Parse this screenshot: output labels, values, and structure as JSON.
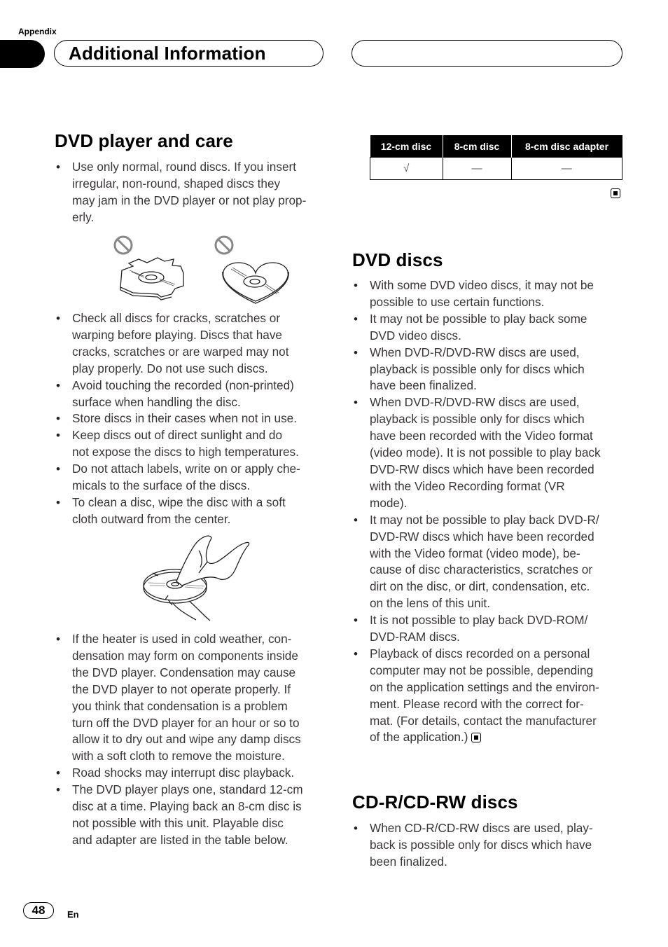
{
  "header": {
    "section_label": "Appendix",
    "chapter_title": "Additional Information"
  },
  "left_column": {
    "heading": "DVD player and care",
    "bullets_top": [
      "Use only normal, round discs. If you insert\nirregular, non-round, shaped discs they\nmay jam in the DVD player or not play prop-\nerly."
    ],
    "figure1_alt": "Irregular-shaped and heart-shaped discs with prohibition signs",
    "bullets_middle": [
      "Check all discs for cracks, scratches or\nwarping before playing. Discs that have\ncracks, scratches or are warped may not\nplay properly. Do not use such discs.",
      "Avoid touching the recorded (non-printed)\nsurface when handling the disc.",
      "Store discs in their cases when not in use.",
      "Keep discs out of direct sunlight and do\nnot expose the discs to high temperatures.",
      "Do not attach labels, write on or apply che-\nmicals to the surface of the discs.",
      "To clean a disc, wipe the disc with a soft\ncloth outward from the center."
    ],
    "figure2_alt": "Hand wiping a disc with a cloth from the center outward",
    "bullets_bottom": [
      "If the heater is used in cold weather, con-\ndensation may form on components inside\nthe DVD player. Condensation may cause\nthe DVD player to not operate properly. If\nyou think that condensation is a problem\nturn off the DVD player for an hour or so to\nallow it to dry out and wipe any damp discs\nwith a soft cloth to remove the moisture.",
      "Road shocks may interrupt disc playback.",
      "The DVD player plays one, standard 12-cm\ndisc at a time. Playing back an 8-cm disc is\nnot possible with this unit. Playable disc\nand adapter are listed in the table below."
    ]
  },
  "disc_table": {
    "headers": [
      "12-cm disc",
      "8-cm disc",
      "8-cm disc adapter"
    ],
    "rows": [
      [
        "√",
        "—",
        "—"
      ]
    ]
  },
  "dvd_discs": {
    "heading": "DVD discs",
    "bullets": [
      "With some DVD video discs, it may not be\npossible to use certain functions.",
      "It may not be possible to play back some\nDVD video discs.",
      "When DVD-R/DVD-RW discs are used,\nplayback is possible only for discs which\nhave been finalized.",
      "When DVD-R/DVD-RW discs are used,\nplayback is possible only for discs which\nhave been recorded with the Video format\n(video mode). It is not possible to play back\nDVD-RW discs which have been recorded\nwith the Video Recording format (VR\nmode).",
      "It may not be possible to play back DVD-R/\nDVD-RW discs which have been recorded\nwith the Video format (video mode), be-\ncause of disc characteristics, scratches or\ndirt on the disc, or dirt, condensation, etc.\non the lens of this unit.",
      "It is not possible to play back DVD-ROM/\nDVD-RAM discs.",
      "Playback of discs recorded on a personal\ncomputer may not be possible, depending\non the application settings and the environ-\nment. Please record with the correct for-\nmat. (For details, contact the manufacturer\nof the application.)"
    ]
  },
  "cd_discs": {
    "heading": "CD-R/CD-RW discs",
    "bullets": [
      "When CD-R/CD-RW discs are used, play-\nback is possible only for discs which have\nbeen finalized."
    ]
  },
  "footer": {
    "page_number": "48",
    "language": "En"
  },
  "icons": {
    "end_of_section": "stop-square-icon",
    "prohibited": "no-symbol-icon"
  }
}
